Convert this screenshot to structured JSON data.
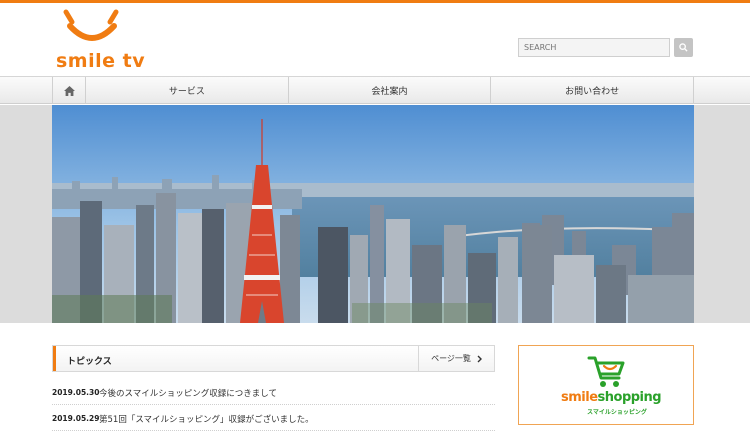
{
  "brand": {
    "logo_text": "smile tv",
    "accent_color": "#f07c12"
  },
  "search": {
    "placeholder": "SEARCH",
    "icon": "search-icon"
  },
  "nav": {
    "home_icon": "home-icon",
    "items": [
      {
        "label": "サービス"
      },
      {
        "label": "会社案内"
      },
      {
        "label": "お問い合わせ"
      }
    ]
  },
  "hero": {
    "image": "Tokyo skyline with Tokyo Tower"
  },
  "topics": {
    "title": "トピックス",
    "more_label": "ページ一覧",
    "items": [
      {
        "date": "2019.05.30",
        "title": "今後のスマイルショッピング収録につきまして"
      },
      {
        "date": "2019.05.29",
        "title": "第51回「スマイルショッピング」収録がございました。"
      }
    ]
  },
  "banner": {
    "name_part1": "smile",
    "name_part2": "shopping",
    "subtitle": "スマイルショッピング"
  }
}
